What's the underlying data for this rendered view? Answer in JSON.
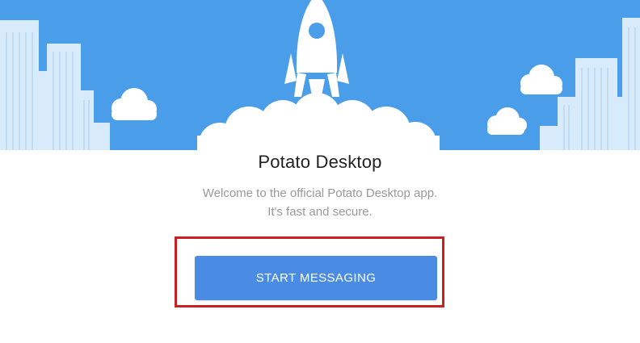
{
  "app": {
    "title": "Potato Desktop",
    "welcome_line_1": "Welcome to the official Potato Desktop app.",
    "welcome_line_2": "It's fast and secure."
  },
  "actions": {
    "start_label": "START MESSAGING"
  },
  "hero": {
    "illustration": "rocket-launch-city-icon",
    "sky_color": "#4a9de9",
    "building_color": "#d8ebfb",
    "cloud_color": "#ffffff"
  },
  "highlight": {
    "color": "#cc1f24",
    "target": "start-messaging-button"
  }
}
